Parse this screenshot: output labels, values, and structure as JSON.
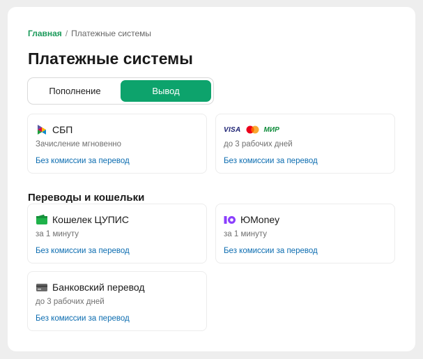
{
  "breadcrumb": {
    "home": "Главная",
    "separator": "/",
    "current": "Платежные системы"
  },
  "page_title": "Платежные системы",
  "tabs": [
    {
      "label": "Пополнение",
      "active": false
    },
    {
      "label": "Вывод",
      "active": true
    }
  ],
  "top_methods": [
    {
      "title": "СБП",
      "icon": "sbp-icon",
      "subtitle": "Зачисление мгновенно",
      "fee": "Без комиссии за перевод"
    },
    {
      "brands": [
        "VISA",
        "Mastercard",
        "МИР"
      ],
      "brand_labels": {
        "visa": "VISA",
        "mir": "МИР"
      },
      "icons": [
        "visa-logo",
        "mastercard-logo",
        "mir-logo"
      ],
      "subtitle": "до 3 рабочих дней",
      "fee": "Без комиссии за перевод"
    }
  ],
  "section_title": "Переводы и кошельки",
  "wallets": [
    {
      "title": "Кошелек ЦУПИС",
      "icon": "cupis-wallet-icon",
      "subtitle": "за 1 минуту",
      "fee": "Без комиссии за перевод"
    },
    {
      "title": "ЮMoney",
      "icon": "yoomoney-icon",
      "subtitle": "за 1 минуту",
      "fee": "Без комиссии за перевод"
    },
    {
      "title": "Банковский перевод",
      "icon": "bank-card-icon",
      "subtitle": "до 3 рабочих дней",
      "fee": "Без комиссии за перевод"
    }
  ],
  "colors": {
    "accent": "#0da36c",
    "breadcrumb_link": "#1a9a5a",
    "fee_link": "#0b6cb0",
    "yoomoney": "#8b3ffd",
    "cupis": "#1fb24a"
  }
}
